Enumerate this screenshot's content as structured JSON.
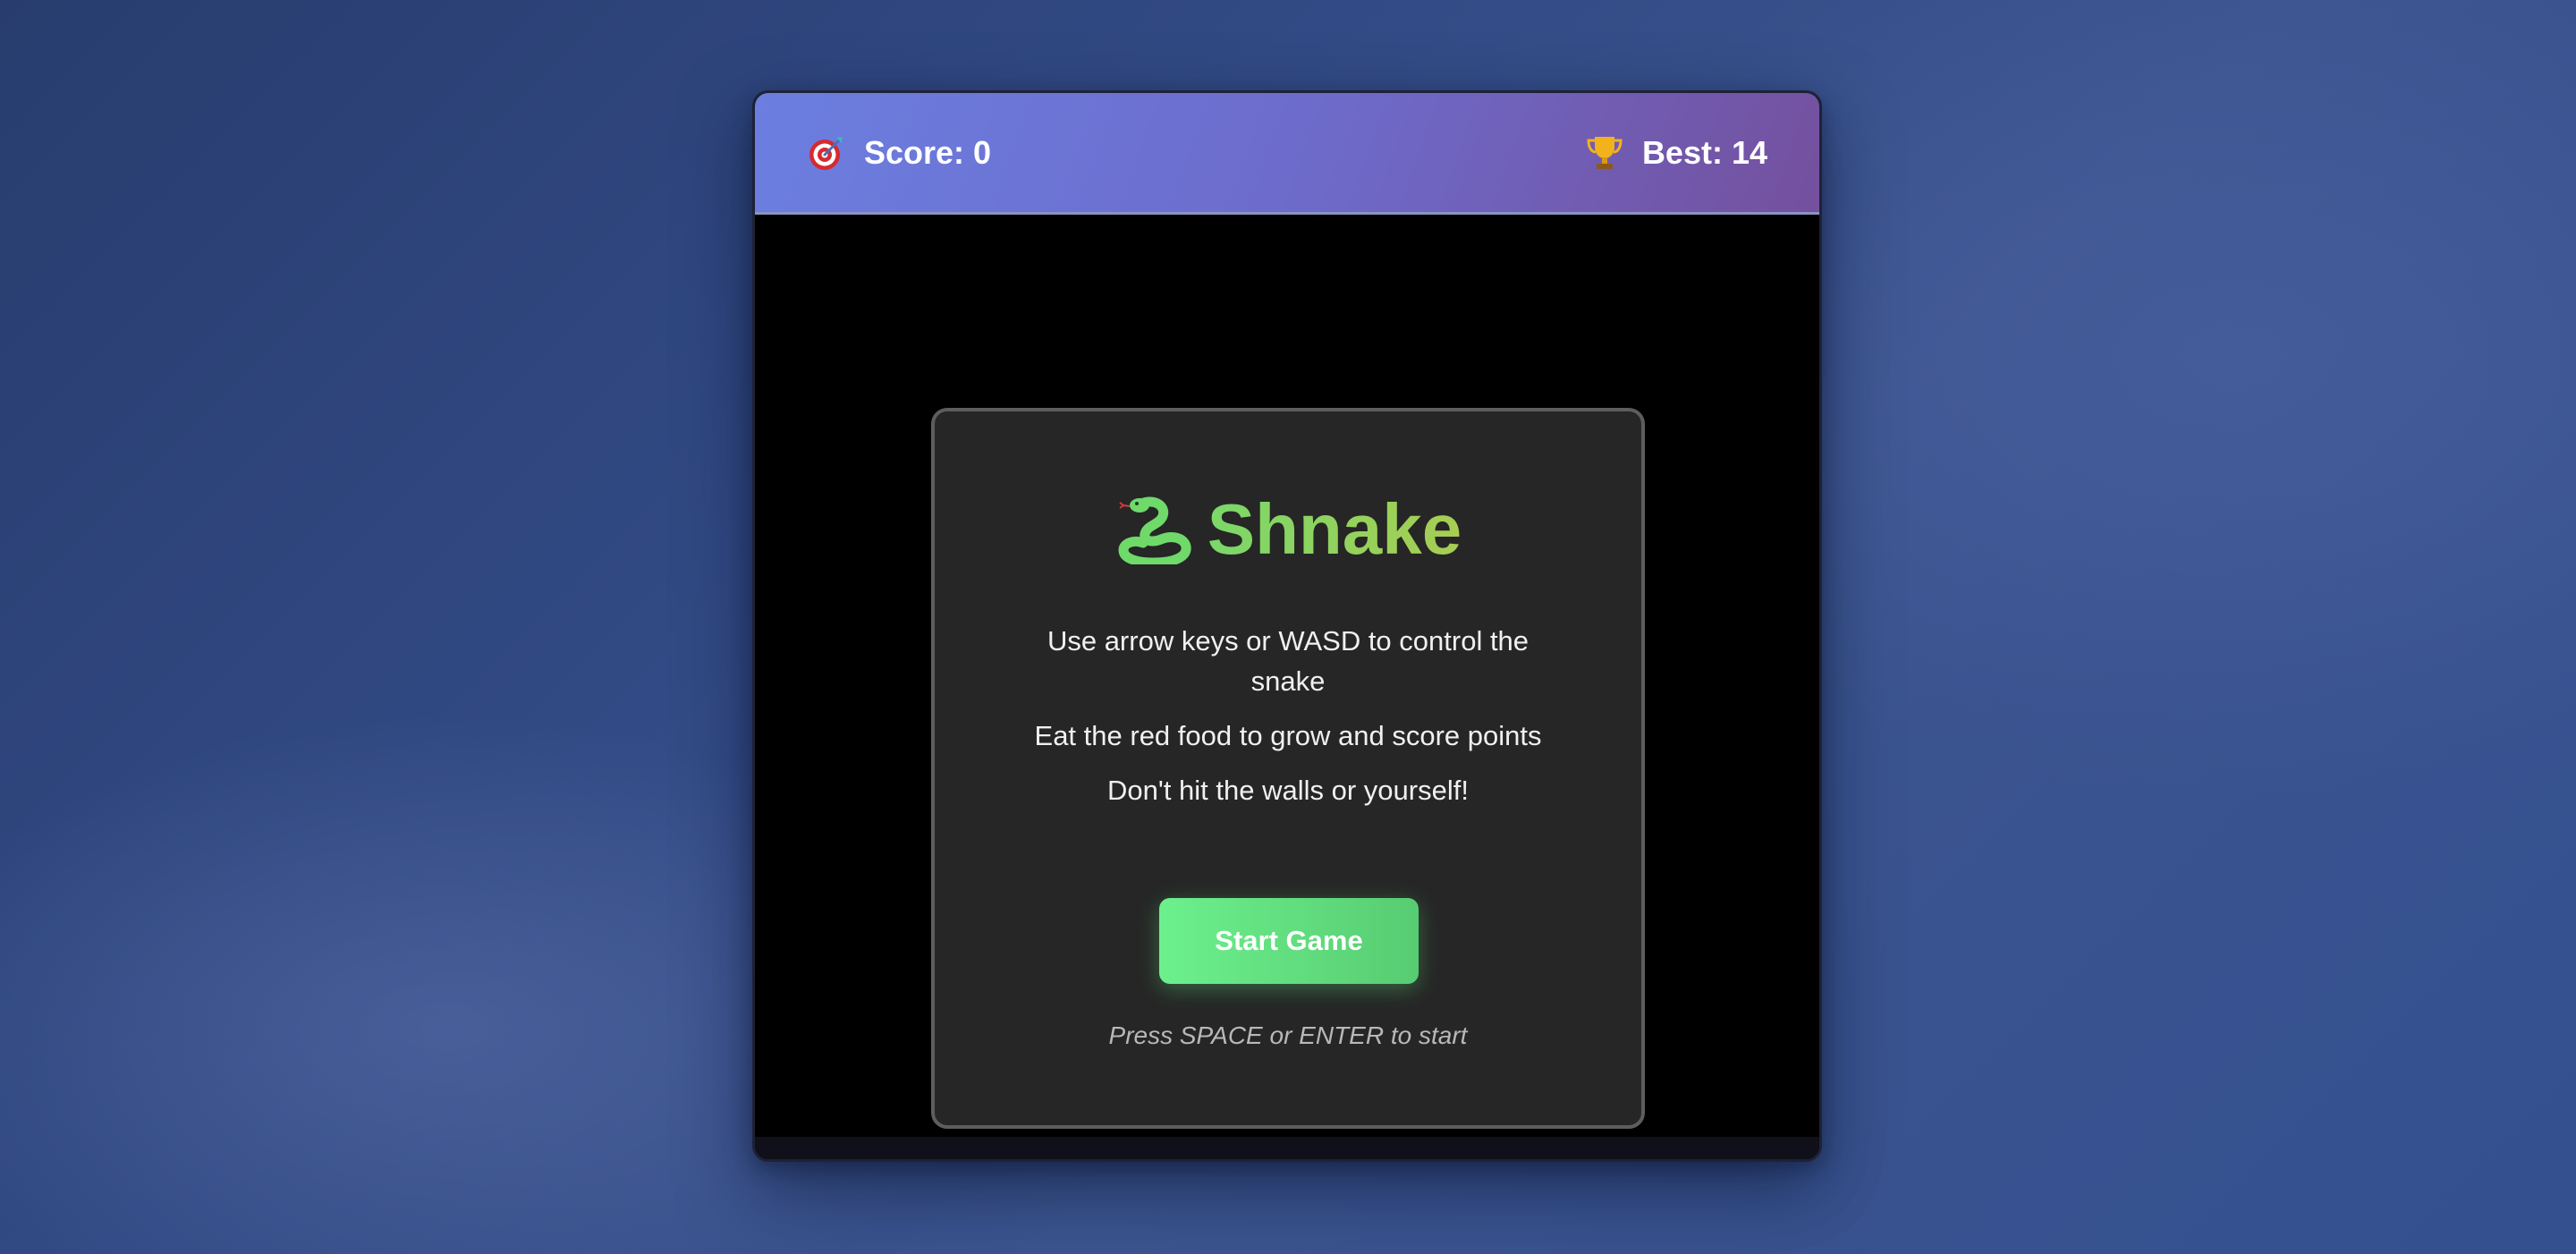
{
  "header": {
    "score_icon": "target-icon",
    "score_text": "Score: 0",
    "best_icon": "trophy-icon",
    "best_text": "Best: 14"
  },
  "start_screen": {
    "logo_icon": "snake-icon",
    "title": "Shnake",
    "instructions": [
      "Use arrow keys or WASD to control the snake",
      "Eat the red food to grow and score points",
      "Don't hit the walls or yourself!"
    ],
    "start_button_label": "Start Game",
    "hint": "Press SPACE or ENTER to start"
  },
  "colors": {
    "header_gradient_start": "#6b7fe0",
    "header_gradient_end": "#74509e",
    "title_green": "#7ad86a",
    "button_green": "#6cf08d",
    "panel_background": "#262626",
    "board_background": "#000000"
  }
}
